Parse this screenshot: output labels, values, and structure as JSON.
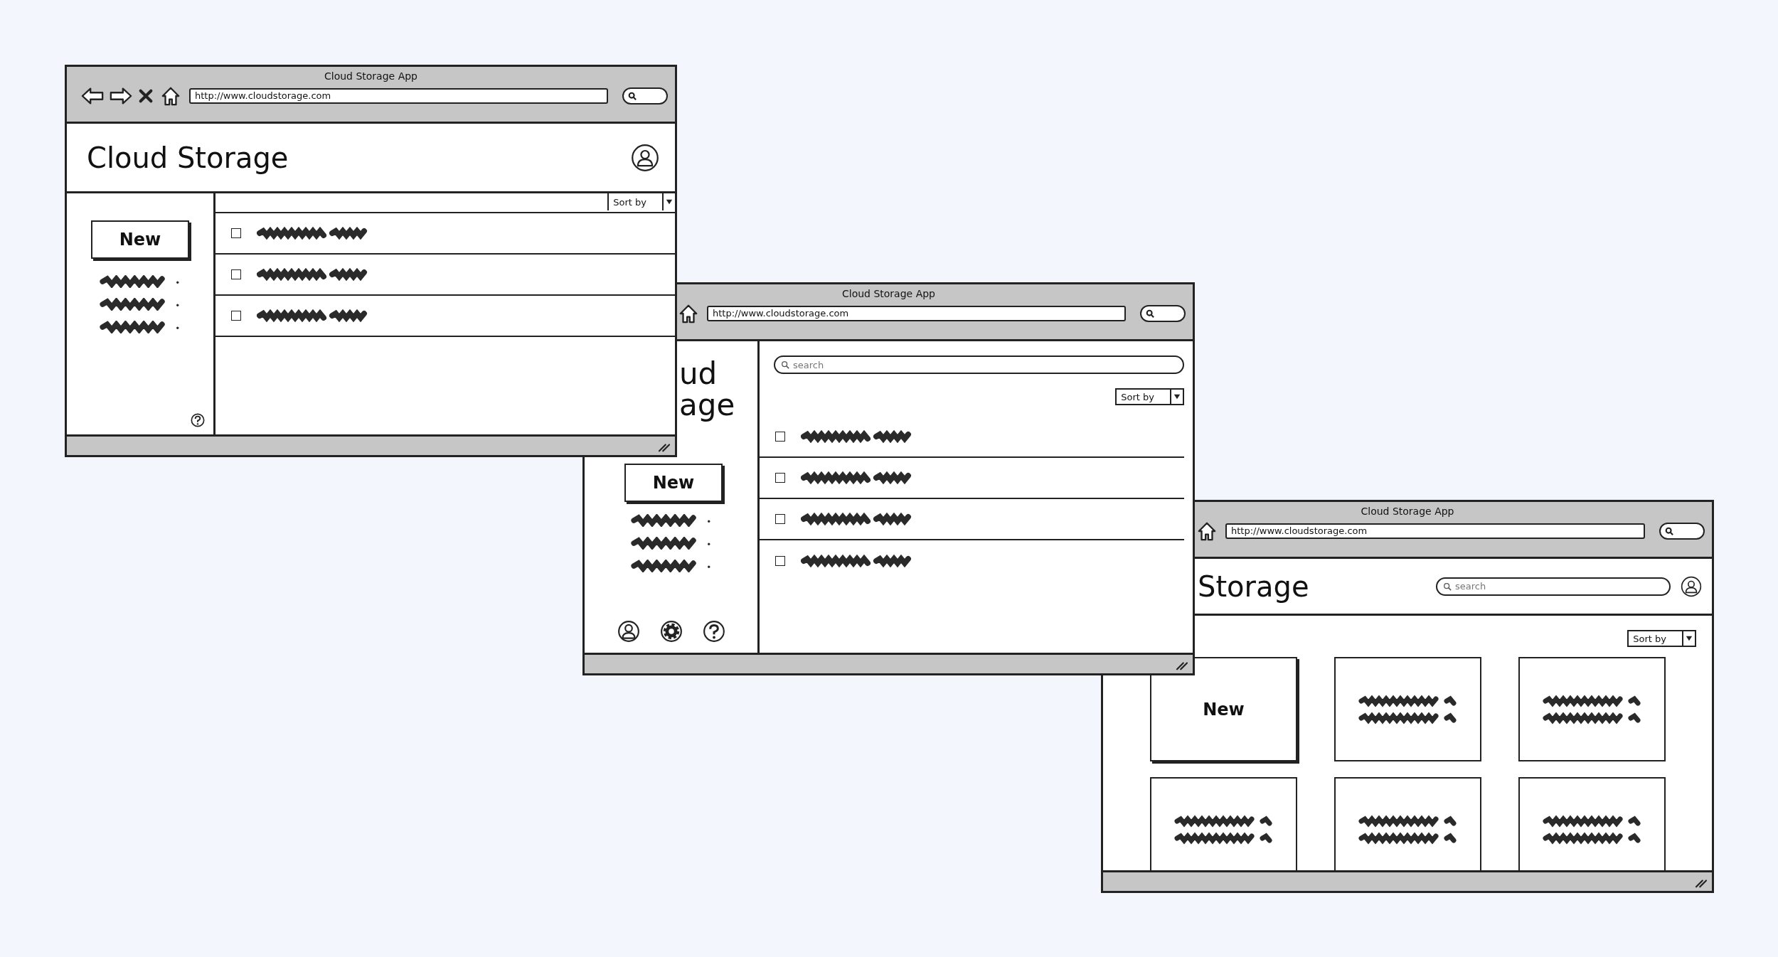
{
  "windows": [
    {
      "kind": "header-list",
      "title": "Cloud Storage App",
      "url": "http://www.cloudstorage.com",
      "nav": [
        {
          "kind": "back"
        },
        {
          "kind": "forward"
        },
        {
          "kind": "stop"
        },
        {
          "kind": "home"
        }
      ],
      "heading": "Cloud Storage",
      "new_button": "New",
      "sidebar_items": [
        {
          "kind": "scribble"
        },
        {
          "kind": "scribble"
        },
        {
          "kind": "scribble"
        }
      ],
      "sidebar_icons": [
        {
          "kind": "help"
        }
      ],
      "sort_label": "Sort by",
      "rows": [
        {
          "checked": false
        },
        {
          "checked": false
        },
        {
          "checked": false
        }
      ]
    },
    {
      "kind": "sidebar-list",
      "title": "Cloud Storage App",
      "url": "http://www.cloudstorage.com",
      "nav": [
        {
          "kind": "home"
        }
      ],
      "heading_fragments": [
        "ud",
        "age"
      ],
      "new_button": "New",
      "sidebar_items": [
        {
          "kind": "scribble"
        },
        {
          "kind": "scribble"
        },
        {
          "kind": "scribble"
        }
      ],
      "sidebar_icons": [
        {
          "kind": "user"
        },
        {
          "kind": "settings"
        },
        {
          "kind": "help"
        }
      ],
      "search_placeholder": "search",
      "sort_label": "Sort by",
      "rows": [
        {
          "checked": false
        },
        {
          "checked": false
        },
        {
          "checked": false
        },
        {
          "checked": false
        }
      ]
    },
    {
      "kind": "grid",
      "title": "Cloud Storage App",
      "url": "http://www.cloudstorage.com",
      "nav": [
        {
          "kind": "home"
        }
      ],
      "heading": "Storage",
      "search_placeholder": "search",
      "sort_label": "Sort by",
      "cards": [
        {
          "kind": "new",
          "label": "New"
        },
        {
          "kind": "file"
        },
        {
          "kind": "file"
        },
        {
          "kind": "file"
        },
        {
          "kind": "file"
        },
        {
          "kind": "file"
        }
      ]
    }
  ]
}
